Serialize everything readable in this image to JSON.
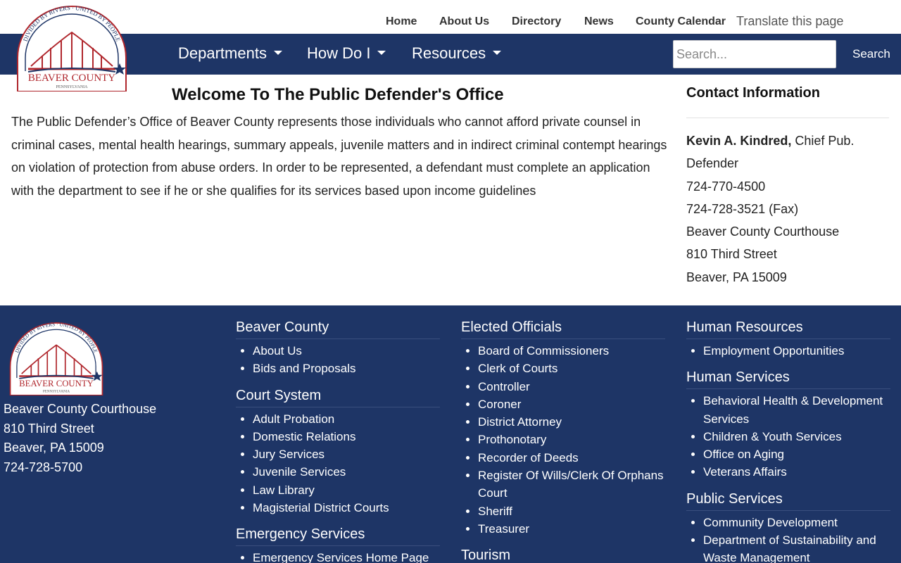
{
  "top_nav": {
    "items": [
      "Home",
      "About Us",
      "Directory",
      "News",
      "County Calendar"
    ],
    "translate": "Translate this page"
  },
  "main_nav": {
    "items": [
      "Departments",
      "How Do I",
      "Resources"
    ],
    "search_placeholder": "Search...",
    "search_button": "Search"
  },
  "logo": {
    "top_text": "DIVIDED BY RIVERS · UNITED BY PEOPLE",
    "name": "BEAVER COUNTY",
    "state": "PENNSYLVANIA"
  },
  "main": {
    "title": "Welcome To The Public Defender's Office",
    "intro": "The Public Defender’s Office of Beaver County represents those individuals who cannot afford private counsel in criminal cases, mental health hearings, summary appeals, juvenile matters and in indirect criminal contempt hearings on violation of protection from abuse orders. In order to be represented, a defendant must complete an application with the department to see if he or she qualifies for its services based upon income guidelines"
  },
  "contact": {
    "title": "Contact Information",
    "name": "Kevin A. Kindred,",
    "role": "Chief Pub. Defender",
    "phone": "724-770-4500",
    "fax": "724-728-3521 (Fax)",
    "building": "Beaver County Courthouse",
    "street": "810 Third Street",
    "city": "Beaver, PA 15009"
  },
  "footer": {
    "address": [
      "Beaver County Courthouse",
      "810 Third Street",
      "Beaver, PA 15009",
      "724-728-5700"
    ],
    "columns": [
      {
        "sections": [
          {
            "heading": "Beaver County",
            "links": [
              "About Us",
              "Bids and Proposals"
            ]
          },
          {
            "heading": "Court System",
            "links": [
              "Adult Probation",
              "Domestic Relations",
              "Jury Services",
              "Juvenile Services",
              "Law Library",
              "Magisterial District Courts"
            ]
          },
          {
            "heading": "Emergency Services",
            "links": [
              "Emergency Services Home Page"
            ]
          }
        ]
      },
      {
        "sections": [
          {
            "heading": "Elected Officials",
            "links": [
              "Board of Commissioners",
              "Clerk of Courts",
              "Controller",
              "Coroner",
              "District Attorney",
              "Prothonotary",
              "Recorder of Deeds",
              "Register Of Wills/Clerk Of Orphans Court",
              "Sheriff",
              "Treasurer"
            ]
          },
          {
            "heading": "Tourism",
            "links": []
          }
        ]
      },
      {
        "sections": [
          {
            "heading": "Human Resources",
            "links": [
              "Employment Opportunities"
            ]
          },
          {
            "heading": "Human Services",
            "links": [
              "Behavioral Health & Development Services",
              "Children & Youth Services",
              "Office on Aging",
              "Veterans Affairs"
            ]
          },
          {
            "heading": "Public Services",
            "links": [
              "Community Development",
              "Department of Sustainability and Waste Management"
            ]
          }
        ]
      }
    ]
  },
  "colors": {
    "nav_bg": "#1e3566",
    "logo_red": "#b0272d",
    "logo_blue": "#1e3566"
  }
}
